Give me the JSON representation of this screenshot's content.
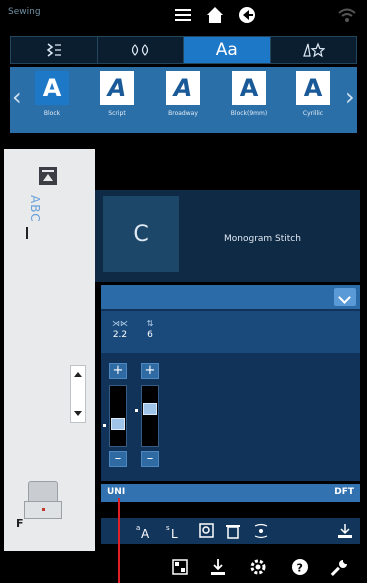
{
  "topbar": {
    "mode_label": "Sewing",
    "icons": [
      "menu-icon",
      "home-icon",
      "back-icon",
      "wifi-icon"
    ]
  },
  "category_tabs": [
    {
      "icon": "stitch-zigzag-icon",
      "label": "",
      "active": false
    },
    {
      "icon": "decorative-stitch-icon",
      "label": "",
      "active": false
    },
    {
      "icon": "alphabet-icon",
      "label": "Aa",
      "active": true
    },
    {
      "icon": "favorites-icon",
      "label": "",
      "active": false
    }
  ],
  "fonts": [
    {
      "label": "Block",
      "glyph": "A",
      "active": true
    },
    {
      "label": "Script",
      "glyph": "A",
      "active": false
    },
    {
      "label": "Broadway",
      "glyph": "A",
      "active": false
    },
    {
      "label": "Block(9mm)",
      "glyph": "A",
      "active": false
    },
    {
      "label": "Cyrillic",
      "glyph": "A",
      "active": false
    }
  ],
  "left_panel": {
    "entered_text": "ABC",
    "presser_foot_letter": "F"
  },
  "stitch": {
    "preview_letter": "C",
    "name": "Monogram Stitch"
  },
  "params": [
    {
      "icon": "stitch-width-icon",
      "value": "2.2"
    },
    {
      "icon": "stitch-length-icon",
      "value": "6"
    }
  ],
  "bottom_buttons": {
    "uni_label": "UNI",
    "dft_label": "DFT"
  },
  "colors": {
    "accent": "#1e78c8",
    "panel_blue": "#2b6fa8",
    "marker_red": "#e01f26"
  }
}
